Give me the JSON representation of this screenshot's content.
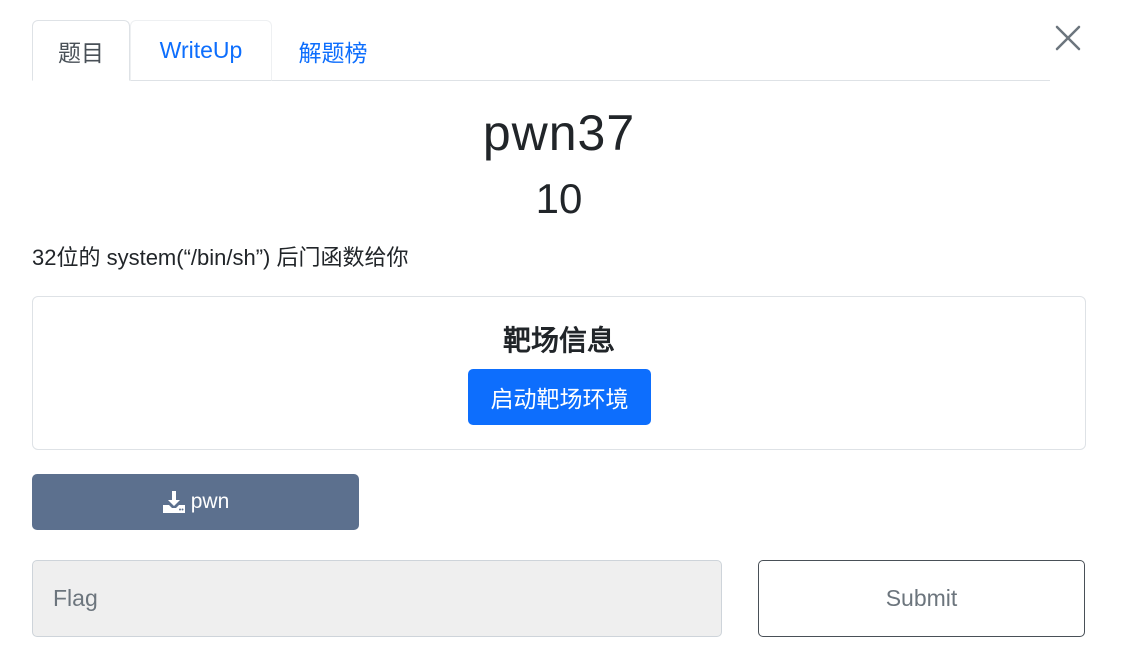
{
  "tabs": [
    {
      "label": "题目",
      "active": true
    },
    {
      "label": "WriteUp",
      "active": false
    },
    {
      "label": "解题榜",
      "active": false
    }
  ],
  "challenge": {
    "name": "pwn37",
    "score": "10",
    "description": "32位的 system(“/bin/sh”) 后门函数给你"
  },
  "target": {
    "title": "靶场信息",
    "start_label": "启动靶场环境"
  },
  "download": {
    "label": "pwn",
    "icon": "download-icon"
  },
  "flag": {
    "placeholder": "Flag",
    "value": ""
  },
  "submit_label": "Submit",
  "icons": {
    "close": "close-icon"
  },
  "colors": {
    "primary": "#0d6efd",
    "download_button": "#5c708e",
    "input_bg": "#efefef"
  }
}
